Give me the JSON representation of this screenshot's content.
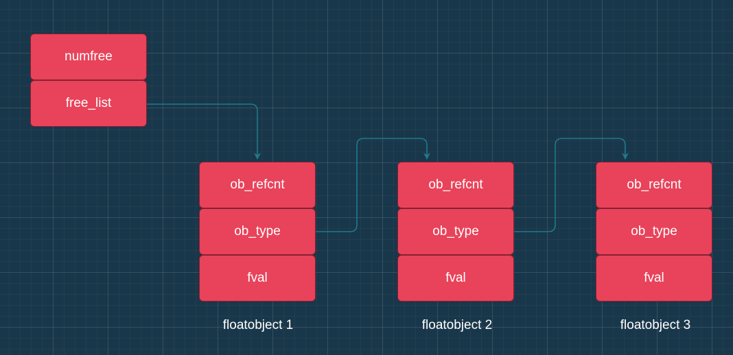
{
  "colors": {
    "background": "#19374a",
    "box_fill": "#e8435a",
    "box_border": "#8a1f33",
    "connector": "#1f7a8c",
    "text": "#ffffff"
  },
  "free_list_head": {
    "fields": [
      "numfree",
      "free_list"
    ]
  },
  "objects": [
    {
      "fields": [
        "ob_refcnt",
        "ob_type",
        "fval"
      ],
      "caption": "floatobject 1"
    },
    {
      "fields": [
        "ob_refcnt",
        "ob_type",
        "fval"
      ],
      "caption": "floatobject 2"
    },
    {
      "fields": [
        "ob_refcnt",
        "ob_type",
        "fval"
      ],
      "caption": "floatobject 3"
    }
  ],
  "links": [
    {
      "from": "free_list",
      "to": "floatobject 1"
    },
    {
      "from": "floatobject 1 ob_type",
      "to": "floatobject 2"
    },
    {
      "from": "floatobject 2 ob_type",
      "to": "floatobject 3"
    }
  ]
}
